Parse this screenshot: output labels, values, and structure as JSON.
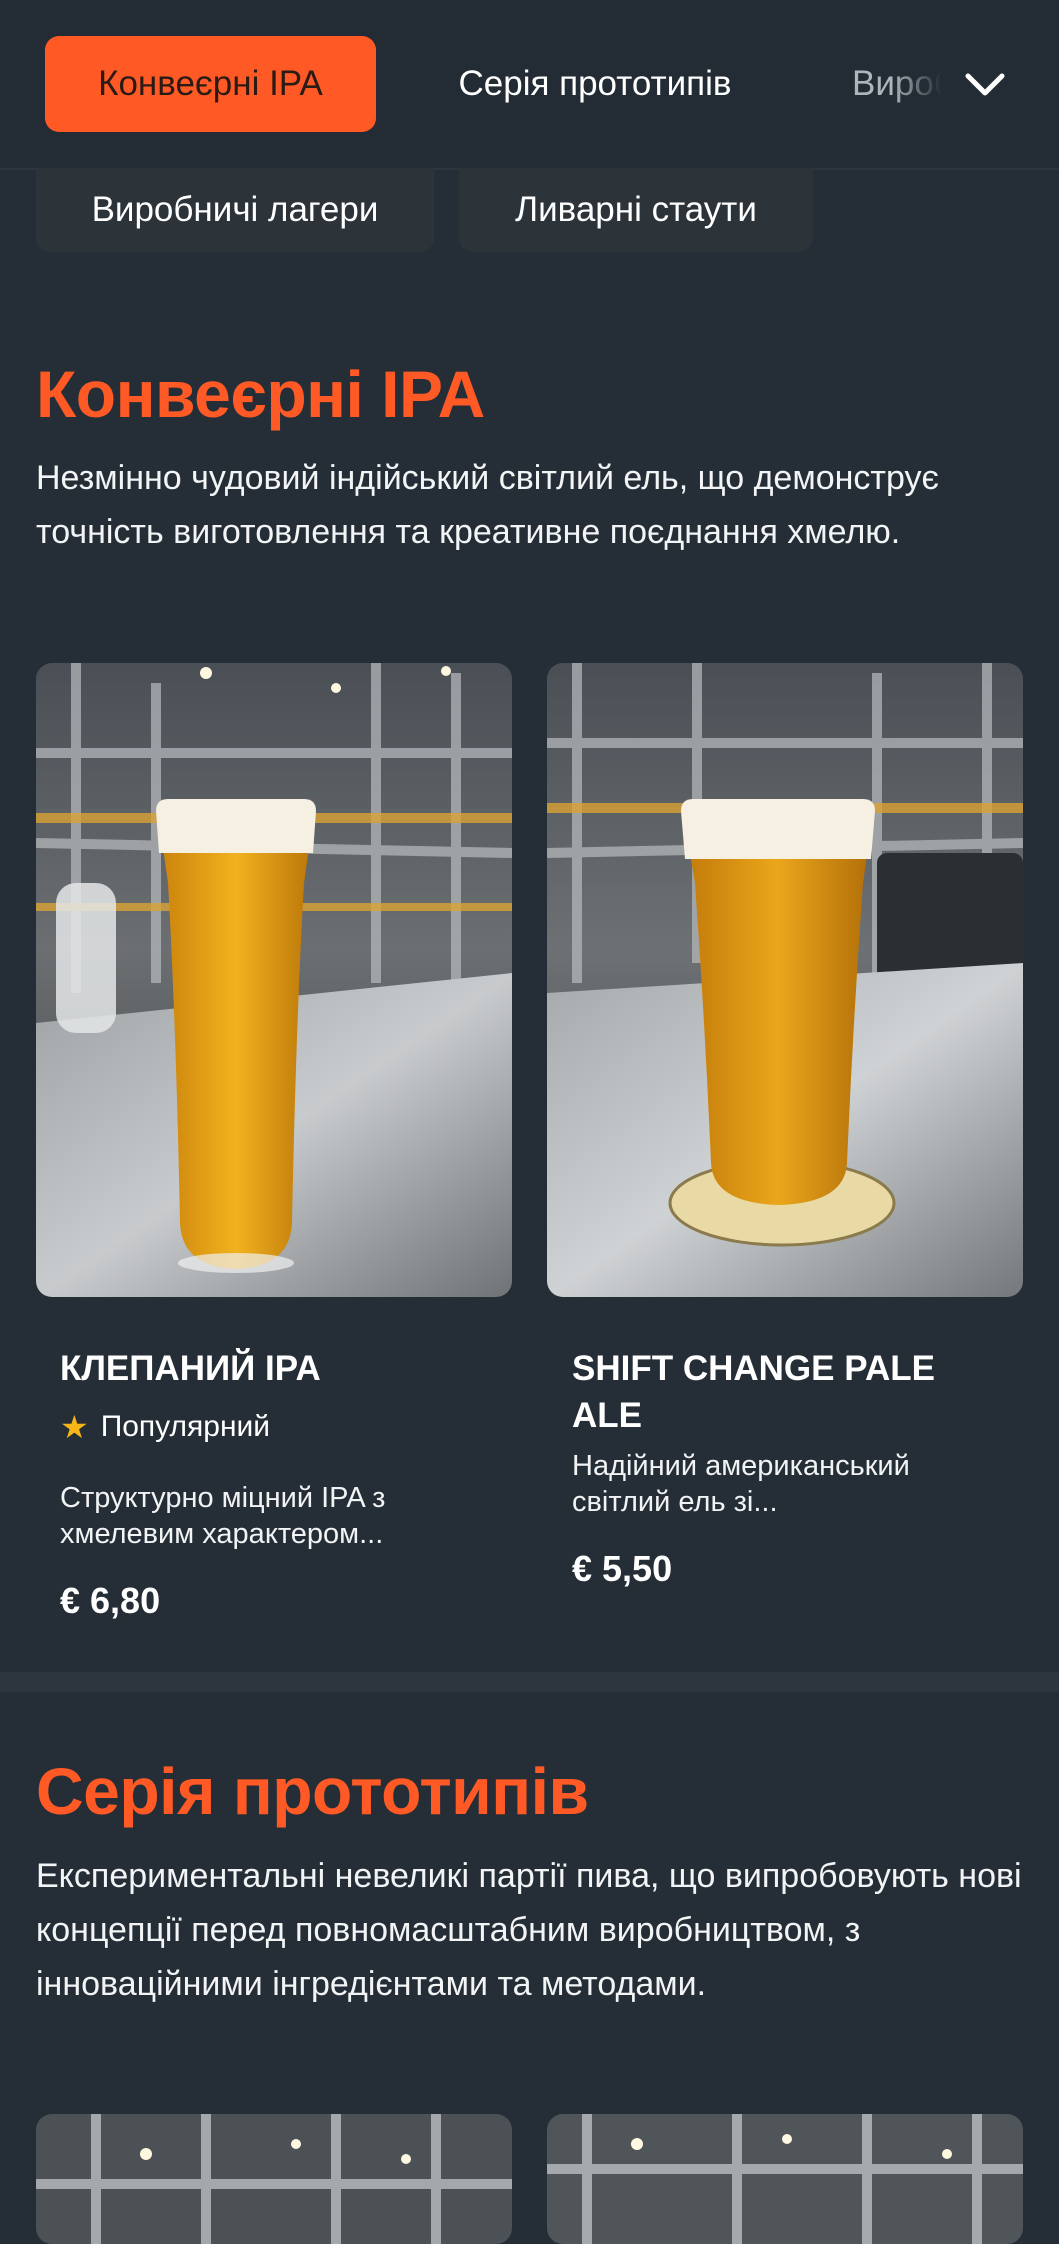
{
  "nav": {
    "tabs": [
      "Конвеєрні IPA",
      "Серія прототипів",
      "Виробничі лагери"
    ],
    "more_icon": "chevron-down-icon",
    "pills": [
      "Виробничі лагери",
      "Ливарні стаути"
    ]
  },
  "sections": [
    {
      "title": "Конвеєрні IPA",
      "description": "Незмінно чудовий індійський світлий ель, що демонструє точність виготовлення та креативне поєднання хмелю.",
      "products": [
        {
          "name": "КЛЕПАНИЙ IPA",
          "badge": "Популярний",
          "description": "Структурно міцний IPA з хмелевим характером...",
          "price": "€ 6,80"
        },
        {
          "name": "SHIFT CHANGE PALE ALE",
          "description": "Надійний американський світлий ель зі...",
          "price": "€ 5,50"
        }
      ]
    },
    {
      "title": "Серія прототипів",
      "description": "Експериментальні невеликі партії пива, що випробовують нові концепції перед повномасштабним виробництвом, з інноваційними інгредієнтами та методами."
    }
  ],
  "colors": {
    "accent": "#ff5a26",
    "background": "#252e36",
    "star": "#f6b619"
  }
}
